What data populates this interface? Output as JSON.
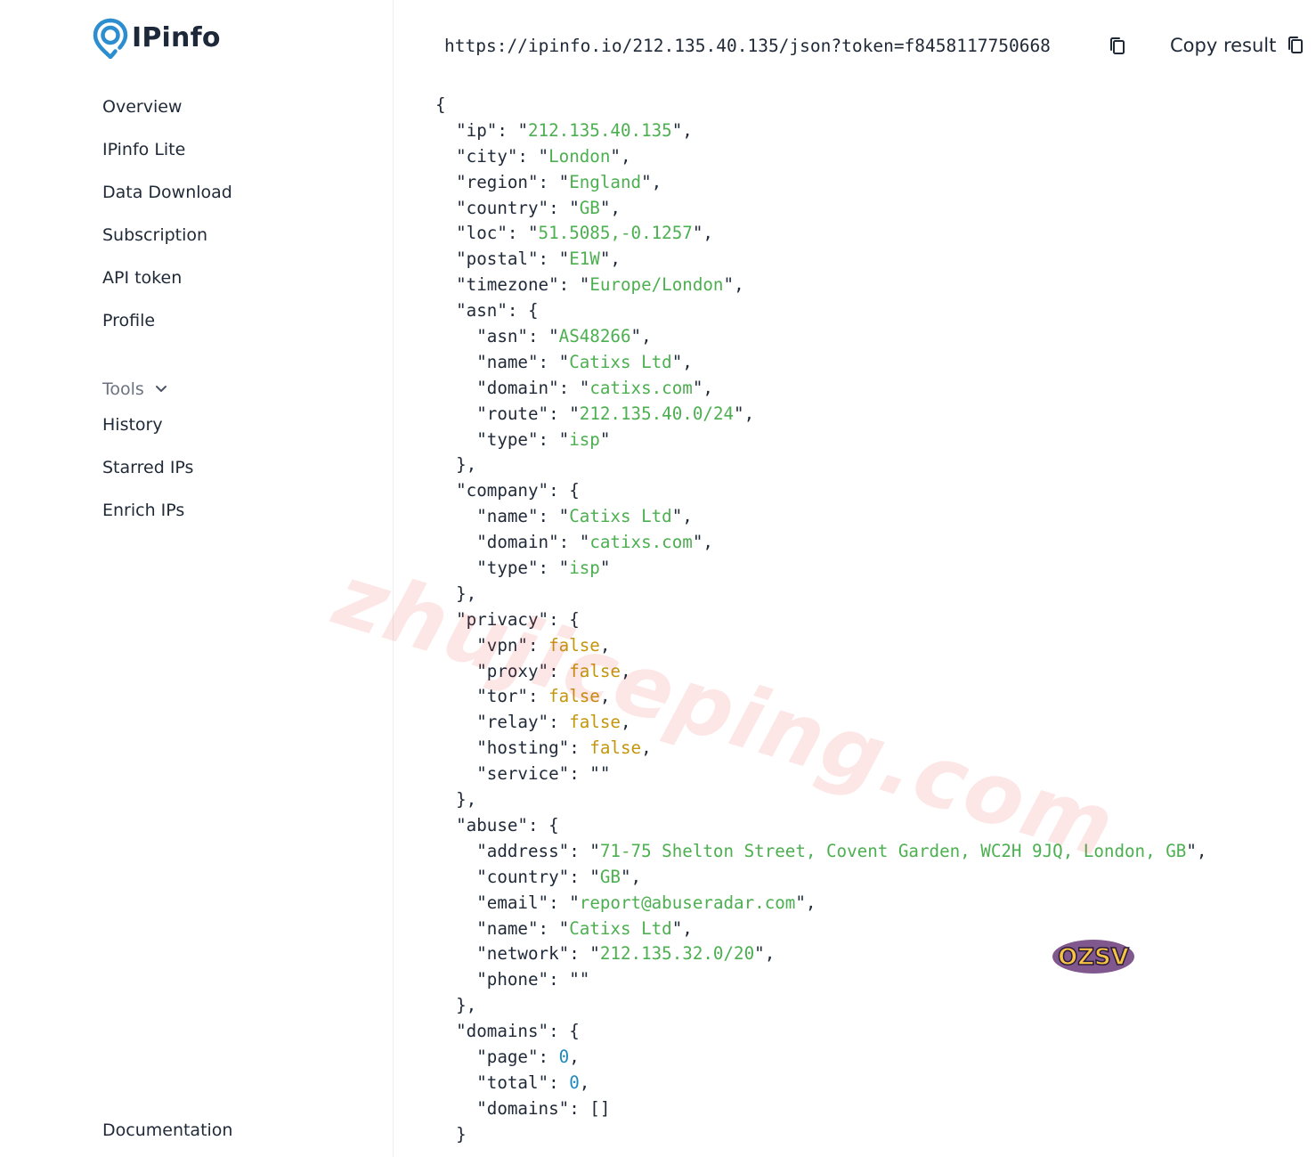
{
  "brand": {
    "name": "IPinfo",
    "color": "#2d8ecf"
  },
  "sidebar": {
    "items": [
      {
        "label": "Overview"
      },
      {
        "label": "IPinfo Lite"
      },
      {
        "label": "Data Download"
      },
      {
        "label": "Subscription"
      },
      {
        "label": "API token"
      },
      {
        "label": "Profile"
      }
    ],
    "tools": {
      "label": "Tools",
      "icon": "chevron-down-icon",
      "items": [
        {
          "label": "History"
        },
        {
          "label": "Starred IPs"
        },
        {
          "label": "Enrich IPs"
        }
      ]
    },
    "footer_link": "Documentation"
  },
  "request": {
    "url": "https://ipinfo.io/212.135.40.135/json?token=f8458117750668",
    "copy_icon": "copy-icon"
  },
  "copy_result": {
    "label": "Copy result",
    "icon": "copy-icon"
  },
  "colors": {
    "string": "#4caf50",
    "boolean": "#c4960c",
    "number": "#1f8ac0"
  },
  "json_result": [
    {
      "indent": 0,
      "t": "{"
    },
    {
      "indent": 1,
      "key": "ip",
      "str": "212.135.40.135",
      "comma": true
    },
    {
      "indent": 1,
      "key": "city",
      "str": "London",
      "comma": true
    },
    {
      "indent": 1,
      "key": "region",
      "str": "England",
      "comma": true
    },
    {
      "indent": 1,
      "key": "country",
      "str": "GB",
      "comma": true
    },
    {
      "indent": 1,
      "key": "loc",
      "str": "51.5085,-0.1257",
      "comma": true
    },
    {
      "indent": 1,
      "key": "postal",
      "str": "E1W",
      "comma": true
    },
    {
      "indent": 1,
      "key": "timezone",
      "str": "Europe/London",
      "comma": true
    },
    {
      "indent": 1,
      "key": "asn",
      "open": "{"
    },
    {
      "indent": 2,
      "key": "asn",
      "str": "AS48266",
      "comma": true
    },
    {
      "indent": 2,
      "key": "name",
      "str": "Catixs Ltd",
      "comma": true
    },
    {
      "indent": 2,
      "key": "domain",
      "str": "catixs.com",
      "comma": true
    },
    {
      "indent": 2,
      "key": "route",
      "str": "212.135.40.0/24",
      "comma": true
    },
    {
      "indent": 2,
      "key": "type",
      "str": "isp"
    },
    {
      "indent": 1,
      "t": "},"
    },
    {
      "indent": 1,
      "key": "company",
      "open": "{"
    },
    {
      "indent": 2,
      "key": "name",
      "str": "Catixs Ltd",
      "comma": true
    },
    {
      "indent": 2,
      "key": "domain",
      "str": "catixs.com",
      "comma": true
    },
    {
      "indent": 2,
      "key": "type",
      "str": "isp"
    },
    {
      "indent": 1,
      "t": "},"
    },
    {
      "indent": 1,
      "key": "privacy",
      "open": "{"
    },
    {
      "indent": 2,
      "key": "vpn",
      "bool": "false",
      "comma": true
    },
    {
      "indent": 2,
      "key": "proxy",
      "bool": "false",
      "comma": true
    },
    {
      "indent": 2,
      "key": "tor",
      "bool": "false",
      "comma": true
    },
    {
      "indent": 2,
      "key": "relay",
      "bool": "false",
      "comma": true
    },
    {
      "indent": 2,
      "key": "hosting",
      "bool": "false",
      "comma": true
    },
    {
      "indent": 2,
      "key": "service",
      "str": ""
    },
    {
      "indent": 1,
      "t": "},"
    },
    {
      "indent": 1,
      "key": "abuse",
      "open": "{"
    },
    {
      "indent": 2,
      "key": "address",
      "str": "71-75 Shelton Street, Covent Garden, WC2H 9JQ, London, GB",
      "comma": true
    },
    {
      "indent": 2,
      "key": "country",
      "str": "GB",
      "comma": true
    },
    {
      "indent": 2,
      "key": "email",
      "str": "report@abuseradar.com",
      "comma": true
    },
    {
      "indent": 2,
      "key": "name",
      "str": "Catixs Ltd",
      "comma": true
    },
    {
      "indent": 2,
      "key": "network",
      "str": "212.135.32.0/20",
      "comma": true
    },
    {
      "indent": 2,
      "key": "phone",
      "str": ""
    },
    {
      "indent": 1,
      "t": "},"
    },
    {
      "indent": 1,
      "key": "domains",
      "open": "{"
    },
    {
      "indent": 2,
      "key": "page",
      "num": "0",
      "comma": true
    },
    {
      "indent": 2,
      "key": "total",
      "num": "0",
      "comma": true
    },
    {
      "indent": 2,
      "key": "domains",
      "raw": "[]"
    },
    {
      "indent": 1,
      "t": "}"
    }
  ],
  "watermark": {
    "text": "zhujiceping.com",
    "color": "#e83232"
  },
  "badge": {
    "text": "OZSV"
  }
}
